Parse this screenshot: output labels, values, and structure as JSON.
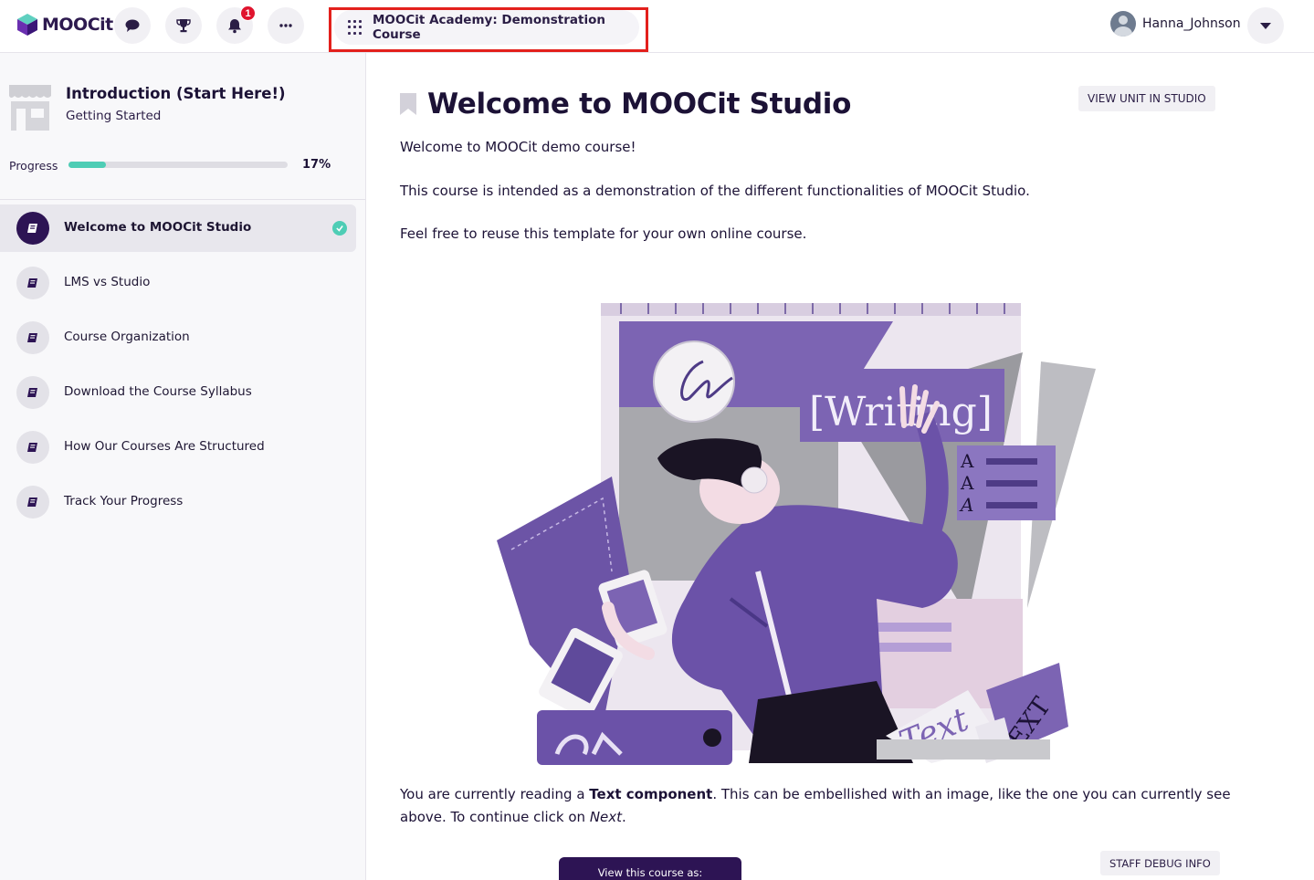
{
  "brand": {
    "name": "MOOCit",
    "accent": "#2d1454",
    "progress_color": "#4ecdb5"
  },
  "topbar": {
    "icons": [
      "chat-icon",
      "trophy-icon",
      "bell-icon",
      "more-icon"
    ],
    "notifications_count": "1",
    "course_switch_label": "MOOCit Academy: Demonstration Course",
    "username": "Hanna_Johnson"
  },
  "sidebar": {
    "section_title": "Introduction (Start Here!)",
    "section_subtitle": "Getting Started",
    "progress_label": "Progress",
    "progress_percent": "17%",
    "progress_value": 0.17,
    "units": [
      {
        "label": "Welcome to MOOCit Studio",
        "active": true,
        "completed": true
      },
      {
        "label": "LMS vs Studio",
        "active": false,
        "completed": false
      },
      {
        "label": "Course Organization",
        "active": false,
        "completed": false
      },
      {
        "label": "Download the Course Syllabus",
        "active": false,
        "completed": false
      },
      {
        "label": "How Our Courses Are Structured",
        "active": false,
        "completed": false
      },
      {
        "label": "Track Your Progress",
        "active": false,
        "completed": false
      }
    ]
  },
  "main": {
    "title": "Welcome to MOOCit Studio",
    "view_in_studio": "VIEW UNIT IN STUDIO",
    "paragraphs": [
      "Welcome to MOOCit demo course!",
      "This course is intended as a demonstration of the different functionalities of MOOCit Studio.",
      "Feel free to reuse this template for your own online course."
    ],
    "illustration_text": {
      "writing": "[Writing]",
      "text": "Text",
      "ext": "EXT",
      "letter": "A"
    },
    "bottom": {
      "pre": "You are currently reading a ",
      "bold": "Text component",
      "mid": ". This can be embellished with an image, like the one you can currently see above. To continue click on ",
      "italic": "Next",
      "post": "."
    },
    "view_as_label": "View this course as:",
    "staff_debug": "STAFF DEBUG INFO"
  }
}
